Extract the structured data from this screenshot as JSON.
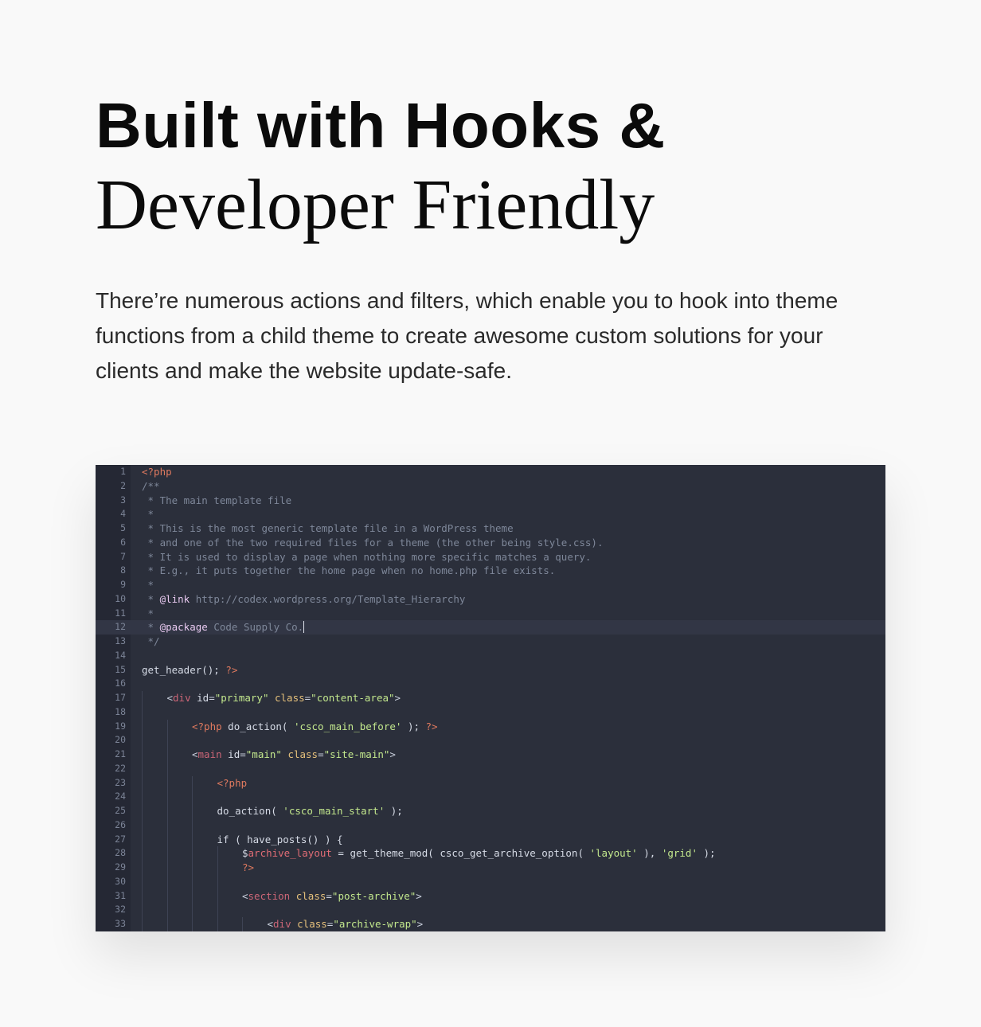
{
  "heading": {
    "line1": "Built with Hooks &",
    "line2": "Developer Friendly"
  },
  "description": {
    "line1": "There’re numerous actions and filters, which enable you to hook into theme",
    "line2": "functions from a child theme to create awesome custom solutions for your",
    "line3": "clients and make the website update-safe."
  },
  "code": {
    "active_line": 12,
    "lines": [
      {
        "n": "1",
        "indent": 0,
        "tokens": [
          [
            "meta",
            "<?php"
          ]
        ]
      },
      {
        "n": "2",
        "indent": 0,
        "tokens": [
          [
            "com",
            "/**"
          ]
        ]
      },
      {
        "n": "3",
        "indent": 0,
        "tokens": [
          [
            "com",
            " * The main template file"
          ]
        ]
      },
      {
        "n": "4",
        "indent": 0,
        "tokens": [
          [
            "com",
            " *"
          ]
        ]
      },
      {
        "n": "5",
        "indent": 0,
        "tokens": [
          [
            "com",
            " * This is the most generic template file in a WordPress theme"
          ]
        ]
      },
      {
        "n": "6",
        "indent": 0,
        "tokens": [
          [
            "com",
            " * and one of the two required files for a theme (the other being style.css)."
          ]
        ]
      },
      {
        "n": "7",
        "indent": 0,
        "tokens": [
          [
            "com",
            " * It is used to display a page when nothing more specific matches a query."
          ]
        ]
      },
      {
        "n": "8",
        "indent": 0,
        "tokens": [
          [
            "com",
            " * E.g., it puts together the home page when no home.php file exists."
          ]
        ]
      },
      {
        "n": "9",
        "indent": 0,
        "tokens": [
          [
            "com",
            " *"
          ]
        ]
      },
      {
        "n": "10",
        "indent": 0,
        "tokens": [
          [
            "com",
            " * "
          ],
          [
            "key",
            "@link"
          ],
          [
            "com",
            " http://codex.wordpress.org/Template_Hierarchy"
          ]
        ]
      },
      {
        "n": "11",
        "indent": 0,
        "tokens": [
          [
            "com",
            " *"
          ]
        ]
      },
      {
        "n": "12",
        "indent": 0,
        "tokens": [
          [
            "com",
            " * "
          ],
          [
            "key",
            "@package"
          ],
          [
            "com",
            " Code Supply Co."
          ]
        ],
        "cursor": true
      },
      {
        "n": "13",
        "indent": 0,
        "tokens": [
          [
            "com",
            " */"
          ]
        ]
      },
      {
        "n": "14",
        "indent": 0,
        "tokens": []
      },
      {
        "n": "15",
        "indent": 0,
        "tokens": [
          [
            "fn",
            "get_header(); "
          ],
          [
            "meta",
            "?>"
          ]
        ]
      },
      {
        "n": "16",
        "indent": 0,
        "tokens": []
      },
      {
        "n": "17",
        "indent": 1,
        "tokens": [
          [
            "pun",
            "<"
          ],
          [
            "tag",
            "div"
          ],
          [
            "pun",
            " "
          ],
          [
            "fn",
            "id"
          ],
          [
            "pun",
            "="
          ],
          [
            "str",
            "\"primary\""
          ],
          [
            "pun",
            " "
          ],
          [
            "attr",
            "class"
          ],
          [
            "pun",
            "="
          ],
          [
            "str",
            "\"content-area\""
          ],
          [
            "pun",
            ">"
          ]
        ]
      },
      {
        "n": "18",
        "indent": 1,
        "tokens": []
      },
      {
        "n": "19",
        "indent": 2,
        "tokens": [
          [
            "meta",
            "<?php"
          ],
          [
            "fn",
            " do_action( "
          ],
          [
            "str",
            "'csco_main_before'"
          ],
          [
            "fn",
            " ); "
          ],
          [
            "meta",
            "?>"
          ]
        ]
      },
      {
        "n": "20",
        "indent": 2,
        "tokens": []
      },
      {
        "n": "21",
        "indent": 2,
        "tokens": [
          [
            "pun",
            "<"
          ],
          [
            "tag",
            "main"
          ],
          [
            "pun",
            " "
          ],
          [
            "fn",
            "id"
          ],
          [
            "pun",
            "="
          ],
          [
            "str",
            "\"main\""
          ],
          [
            "pun",
            " "
          ],
          [
            "attr",
            "class"
          ],
          [
            "pun",
            "="
          ],
          [
            "str",
            "\"site-main\""
          ],
          [
            "pun",
            ">"
          ]
        ]
      },
      {
        "n": "22",
        "indent": 2,
        "tokens": []
      },
      {
        "n": "23",
        "indent": 3,
        "tokens": [
          [
            "meta",
            "<?php"
          ]
        ]
      },
      {
        "n": "24",
        "indent": 3,
        "tokens": []
      },
      {
        "n": "25",
        "indent": 3,
        "tokens": [
          [
            "fn",
            "do_action( "
          ],
          [
            "str",
            "'csco_main_start'"
          ],
          [
            "fn",
            " );"
          ]
        ]
      },
      {
        "n": "26",
        "indent": 3,
        "tokens": []
      },
      {
        "n": "27",
        "indent": 3,
        "tokens": [
          [
            "fn",
            "if ( have_posts() ) {"
          ]
        ]
      },
      {
        "n": "28",
        "indent": 4,
        "tokens": [
          [
            "fn",
            "$"
          ],
          [
            "var",
            "archive_layout"
          ],
          [
            "fn",
            " = get_theme_mod( csco_get_archive_option( "
          ],
          [
            "str",
            "'layout'"
          ],
          [
            "fn",
            " ), "
          ],
          [
            "str",
            "'grid'"
          ],
          [
            "fn",
            " );"
          ]
        ]
      },
      {
        "n": "29",
        "indent": 4,
        "tokens": [
          [
            "meta",
            "?>"
          ]
        ]
      },
      {
        "n": "30",
        "indent": 4,
        "tokens": []
      },
      {
        "n": "31",
        "indent": 4,
        "tokens": [
          [
            "pun",
            "<"
          ],
          [
            "tag",
            "section"
          ],
          [
            "pun",
            " "
          ],
          [
            "attr",
            "class"
          ],
          [
            "pun",
            "="
          ],
          [
            "str",
            "\"post-archive\""
          ],
          [
            "pun",
            ">"
          ]
        ]
      },
      {
        "n": "32",
        "indent": 4,
        "tokens": []
      },
      {
        "n": "33",
        "indent": 5,
        "tokens": [
          [
            "pun",
            "<"
          ],
          [
            "tag",
            "div"
          ],
          [
            "pun",
            " "
          ],
          [
            "attr",
            "class"
          ],
          [
            "pun",
            "="
          ],
          [
            "str",
            "\"archive-wrap\""
          ],
          [
            "pun",
            ">"
          ]
        ]
      }
    ]
  }
}
